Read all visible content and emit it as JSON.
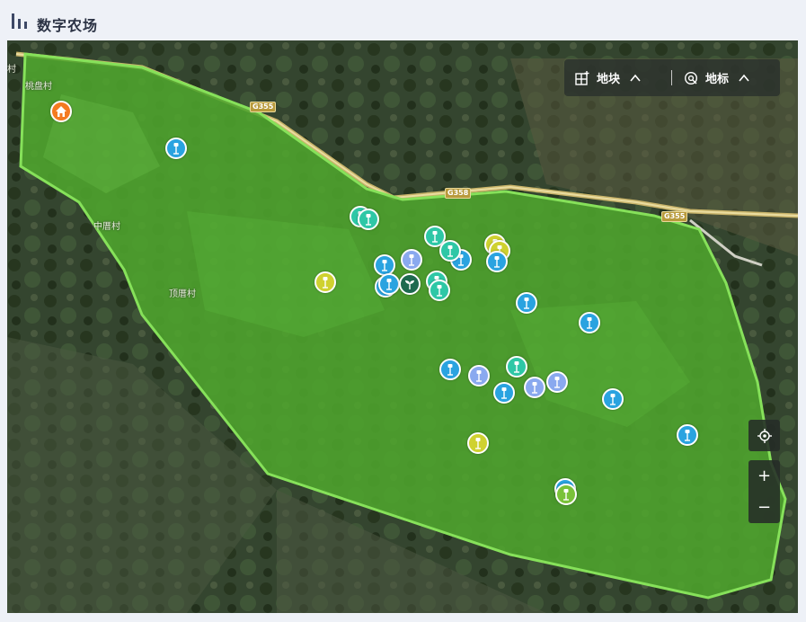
{
  "header": {
    "title": "数字农场",
    "icon": "bar-chart-icon"
  },
  "map": {
    "place_labels": [
      "村",
      "桃盘村",
      "中厝村",
      "顶厝村"
    ],
    "road_labels": [
      "G355",
      "G358",
      "G355"
    ],
    "farm_boundary_color": "#7ad04a",
    "home_icon_color": "#f47a20"
  },
  "controls": {
    "plot_label": "地块",
    "landmark_label": "地标",
    "plot_icon": "grid-plus-icon",
    "landmark_icon": "location-ring-icon",
    "expand_icon": "chevron-up-icon",
    "locate_icon": "crosshair-icon",
    "zoom_in": "+",
    "zoom_out": "−"
  },
  "marker_colors": {
    "blue": "#2aa3e0",
    "teal": "#2ec7a6",
    "lavender": "#8aa9ef",
    "yellow": "#cfd130",
    "green": "#7ac23a",
    "plant": "#1e6a4f"
  },
  "markers": [
    {
      "type": "blue",
      "icon": "sensor-pole-icon"
    },
    {
      "type": "teal",
      "icon": "sensor-pole-icon"
    },
    {
      "type": "teal",
      "icon": "sensor-pole-icon"
    },
    {
      "type": "teal",
      "icon": "sensor-pole-icon"
    },
    {
      "type": "yellow",
      "icon": "sensor-pole-icon"
    },
    {
      "type": "yellow",
      "icon": "sensor-pole-icon"
    },
    {
      "type": "blue",
      "icon": "sensor-pole-icon"
    },
    {
      "type": "teal",
      "icon": "sensor-pole-icon"
    },
    {
      "type": "blue",
      "icon": "sensor-pole-icon"
    },
    {
      "type": "lavender",
      "icon": "sensor-pole-icon"
    },
    {
      "type": "yellow",
      "icon": "sensor-pole-icon"
    },
    {
      "type": "blue",
      "icon": "sensor-pole-icon"
    },
    {
      "type": "blue",
      "icon": "sensor-pole-icon"
    },
    {
      "type": "plant",
      "icon": "plant-sprout-icon"
    },
    {
      "type": "teal",
      "icon": "sensor-pole-icon"
    },
    {
      "type": "teal",
      "icon": "sensor-pole-icon"
    },
    {
      "type": "blue",
      "icon": "sensor-pole-icon"
    },
    {
      "type": "blue",
      "icon": "sensor-pole-icon"
    },
    {
      "type": "blue",
      "icon": "sensor-pole-icon"
    },
    {
      "type": "lavender",
      "icon": "sensor-pole-icon"
    },
    {
      "type": "teal",
      "icon": "sensor-pole-icon"
    },
    {
      "type": "blue",
      "icon": "sensor-pole-icon"
    },
    {
      "type": "lavender",
      "icon": "sensor-pole-icon"
    },
    {
      "type": "lavender",
      "icon": "sensor-pole-icon"
    },
    {
      "type": "blue",
      "icon": "sensor-pole-icon"
    },
    {
      "type": "blue",
      "icon": "sensor-pole-icon"
    },
    {
      "type": "blue",
      "icon": "sensor-pole-icon"
    },
    {
      "type": "yellow",
      "icon": "sensor-pole-icon"
    },
    {
      "type": "blue",
      "icon": "sensor-pole-icon"
    },
    {
      "type": "green",
      "icon": "sensor-pole-icon"
    }
  ]
}
